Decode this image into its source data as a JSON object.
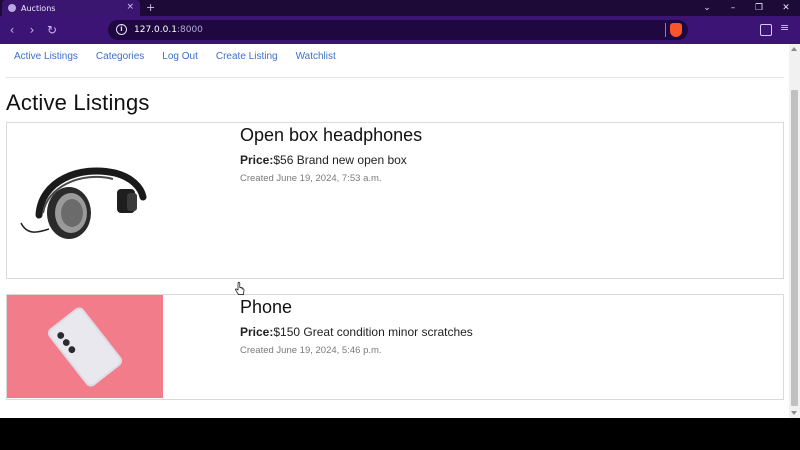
{
  "browser": {
    "tab_title": "Auctions",
    "tab_close": "×",
    "new_tab": "+",
    "url_host": "127.0.0.1",
    "url_port": ":8000",
    "window_controls": [
      "⌄",
      "–",
      "❐",
      "✕"
    ]
  },
  "nav": {
    "items": [
      "Active Listings",
      "Categories",
      "Log Out",
      "Create Listing",
      "Watchlist"
    ]
  },
  "page": {
    "title": "Active Listings"
  },
  "listings": [
    {
      "title": "Open box headphones",
      "price_label": "Price:",
      "price_value": "$56 Brand new open box",
      "created": "Created June 19, 2024, 7:53 a.m.",
      "image_icon": "headphones-image"
    },
    {
      "title": "Phone",
      "price_label": "Price:",
      "price_value": "$150 Great condition minor scratches",
      "created": "Created June 19, 2024, 5:46 p.m.",
      "image_icon": "phone-image"
    }
  ],
  "colors": {
    "chrome_bg": "#3b1476",
    "tabbar_bg": "#1d0a36",
    "link": "#3b71c7",
    "phone_image_bg": "#f27c8a"
  }
}
